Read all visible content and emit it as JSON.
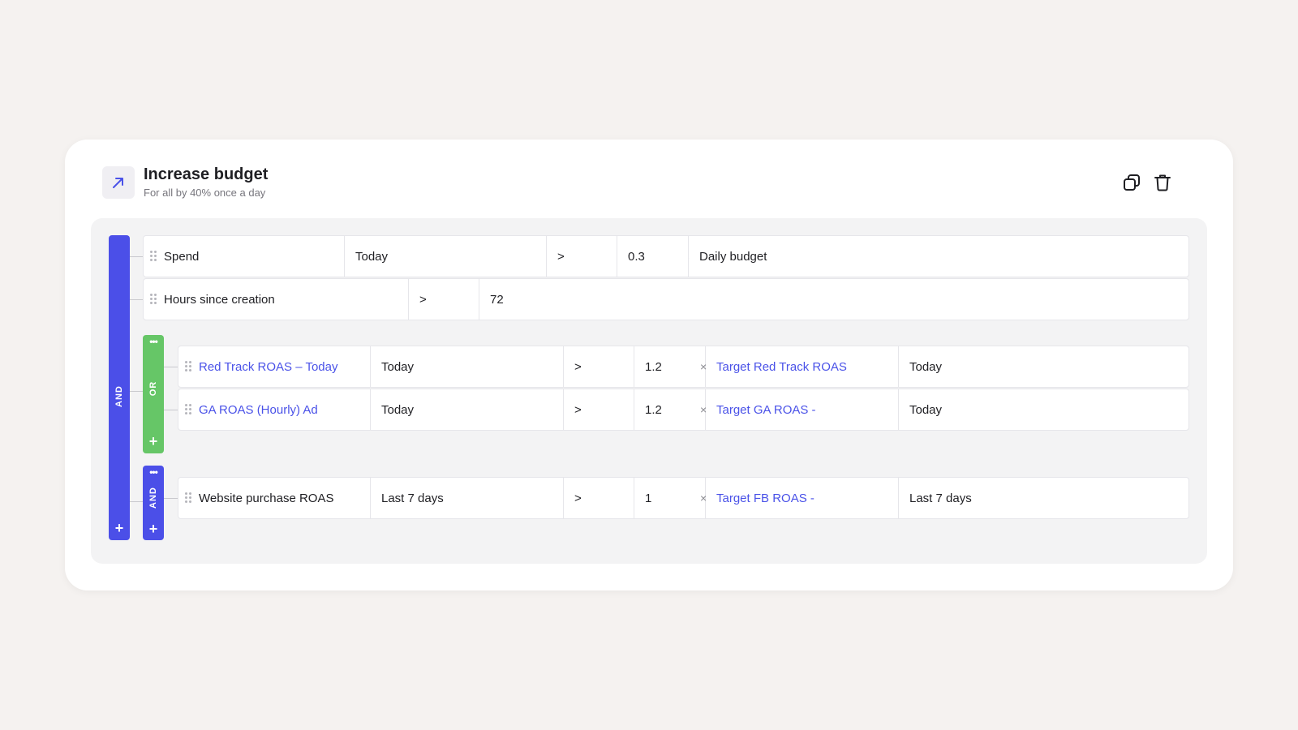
{
  "rule": {
    "title": "Increase budget",
    "subtitle": "For all by 40% once a day",
    "icon": "arrow-up-right-icon",
    "actions": [
      {
        "name": "duplicate",
        "icon": "copy-icon"
      },
      {
        "name": "delete",
        "icon": "trash-icon"
      }
    ]
  },
  "colors": {
    "and_group": "#4b4fe8",
    "or_group": "#66c667",
    "link_text": "#4a52e8"
  },
  "root_group": {
    "operator": "AND",
    "add_symbol": "+",
    "conditions": [
      {
        "metric": "Spend",
        "period": "Today",
        "comparator": ">",
        "value": "0.3",
        "multiply_symbol": "×",
        "reference": "Daily budget"
      },
      {
        "metric": "Hours since creation",
        "comparator": ">",
        "value": "72"
      }
    ],
    "subgroups": [
      {
        "operator": "OR",
        "menu_symbol": "•••",
        "add_symbol": "+",
        "conditions": [
          {
            "metric": "Red Track ROAS – Today",
            "period": "Today",
            "comparator": ">",
            "value": "1.2",
            "multiply_symbol": "×",
            "reference": "Target Red Track ROAS",
            "reference_period": "Today"
          },
          {
            "metric": "GA ROAS (Hourly) Ad",
            "period": "Today",
            "comparator": ">",
            "value": "1.2",
            "multiply_symbol": "×",
            "reference": "Target GA ROAS -",
            "reference_period": "Today"
          }
        ]
      },
      {
        "operator": "AND",
        "menu_symbol": "•••",
        "add_symbol": "+",
        "conditions": [
          {
            "metric": "Website purchase ROAS",
            "period": "Last 7 days",
            "comparator": ">",
            "value": "1",
            "multiply_symbol": "×",
            "reference": "Target FB ROAS -",
            "reference_period": "Last 7 days"
          }
        ]
      }
    ]
  }
}
